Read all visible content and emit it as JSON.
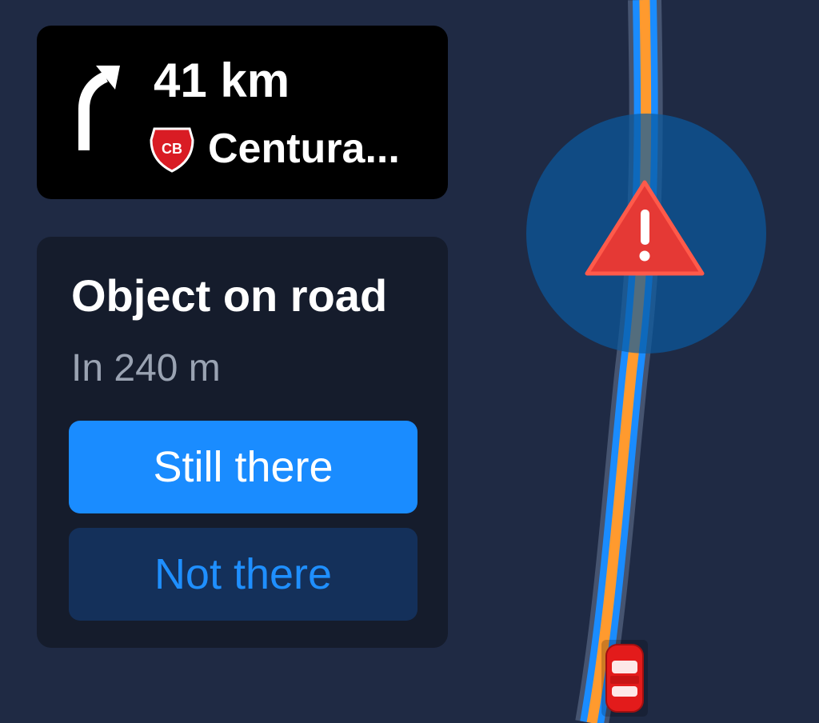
{
  "navigation": {
    "maneuver_icon": "turn-right-arrow-icon",
    "distance": "41 km",
    "road_shield": {
      "icon": "route-shield-icon",
      "text": "CB",
      "color": "#d91c24"
    },
    "road_name": "Centura..."
  },
  "hazard_report": {
    "title": "Object on road",
    "distance": "In 240 m",
    "confirm_label": "Still there",
    "dismiss_label": "Not there"
  },
  "map": {
    "hazard_icon": "warning-triangle-icon",
    "vehicle_icon": "car-icon",
    "route_color": "#ff9a2e",
    "lane_color": "#1a8cff",
    "hazard_color": "#e53935"
  }
}
